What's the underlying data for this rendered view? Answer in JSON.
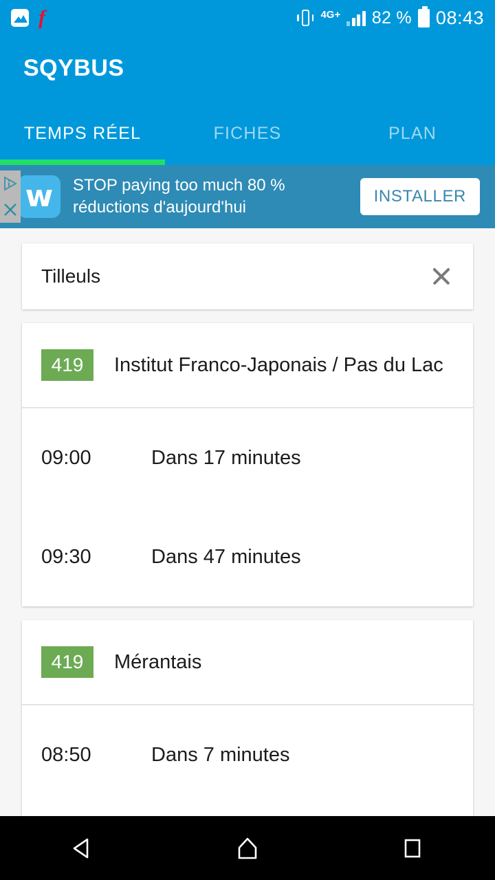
{
  "status_bar": {
    "icons_left": [
      "gallery-icon",
      "free-mobile-f-logo"
    ],
    "vibrate_icon": "vibrate-icon",
    "network": "4G+",
    "signal_icon": "signal-bars-icon",
    "battery_percent": "82 %",
    "battery_icon": "battery-icon",
    "time": "08:43"
  },
  "app": {
    "title": "SQYBUS",
    "accent_blue": "#0098db",
    "indicator_green": "#21e065",
    "tabs": [
      {
        "label": "TEMPS RÉEL",
        "active": true
      },
      {
        "label": "FICHES",
        "active": false
      },
      {
        "label": "PLAN",
        "active": false
      }
    ]
  },
  "ad": {
    "adchoices_icon": "adchoices-icon",
    "close_icon": "ad-close-icon",
    "logo_letter": "w",
    "text": "STOP paying too much 80 % réductions d'aujourd'hui",
    "cta_label": "INSTALLER",
    "background": "#2e8bb5"
  },
  "search": {
    "value": "Tilleuls",
    "placeholder": "Tilleuls",
    "clear_icon": "clear-icon"
  },
  "results": [
    {
      "line": "419",
      "line_color": "#6cab54",
      "destination": "Institut Franco-Japonais / Pas du Lac",
      "departures": [
        {
          "time": "09:00",
          "eta": "Dans 17 minutes"
        },
        {
          "time": "09:30",
          "eta": "Dans 47 minutes"
        }
      ]
    },
    {
      "line": "419",
      "line_color": "#6cab54",
      "destination": "Mérantais",
      "departures": [
        {
          "time": "08:50",
          "eta": "Dans 7 minutes"
        }
      ]
    }
  ],
  "nav_bar": {
    "back_icon": "back-triangle-icon",
    "home_icon": "home-icon",
    "recents_icon": "recents-square-icon"
  }
}
